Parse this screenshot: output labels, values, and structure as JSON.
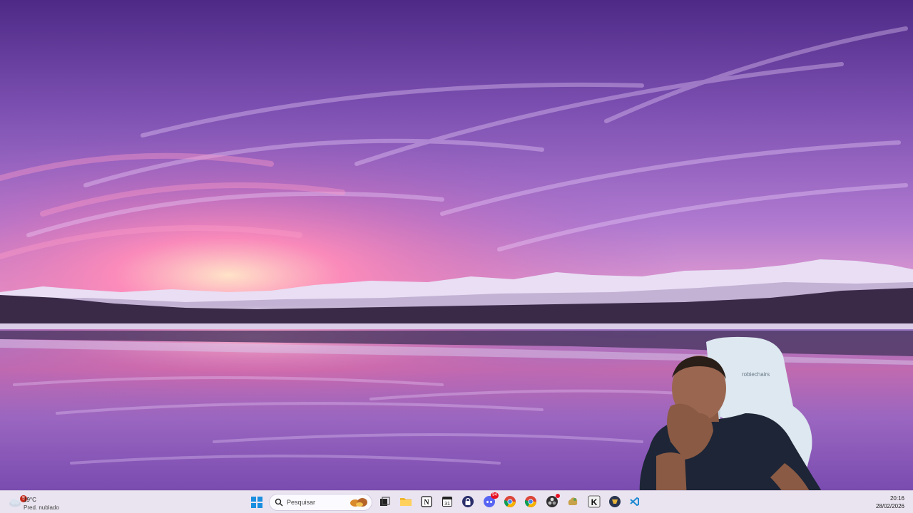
{
  "taskbar": {
    "weather": {
      "temperature": "19°C",
      "description": "Pred. nublado",
      "badge": "9"
    },
    "search": {
      "placeholder": "Pesquisar"
    },
    "apps": [
      {
        "name": "task-view",
        "icon": "task-view-icon"
      },
      {
        "name": "file-explorer",
        "icon": "folder-icon"
      },
      {
        "name": "notion",
        "icon": "notion-icon"
      },
      {
        "name": "calendar",
        "icon": "calendar-icon",
        "label": "31"
      },
      {
        "name": "bitwarden",
        "icon": "lock-icon"
      },
      {
        "name": "discord",
        "icon": "discord-icon",
        "badge": "94"
      },
      {
        "name": "chrome-1",
        "icon": "chrome-icon"
      },
      {
        "name": "chrome-2",
        "icon": "chrome-icon"
      },
      {
        "name": "obs",
        "icon": "obs-icon"
      },
      {
        "name": "app-yellow",
        "icon": "cloud-icon"
      },
      {
        "name": "app-k",
        "icon": "k-app-icon",
        "label": "K"
      },
      {
        "name": "app-game",
        "icon": "game-icon"
      },
      {
        "name": "vscode",
        "icon": "code-icon"
      }
    ],
    "clock": {
      "time": "20:16",
      "date": "28/02/2026"
    }
  },
  "webcam": {
    "chair_brand": "robiechairs"
  },
  "colors": {
    "sky_top": "#5b2f8f",
    "sky_mid": "#9a6bc8",
    "horizon_pink": "#ff8fb8",
    "water": "#8e5fb8",
    "taskbar": "#eae4f0",
    "start_blue": "#1a8fe0"
  }
}
